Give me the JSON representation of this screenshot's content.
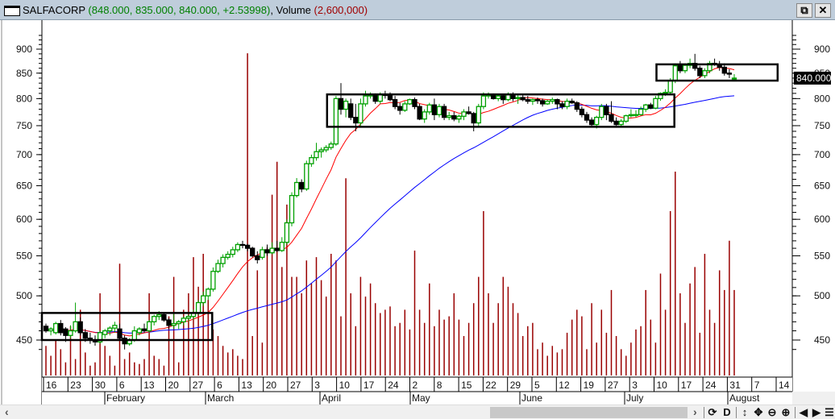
{
  "window": {
    "symbol": "SALFACORP",
    "ohlc_text": "(848.000, 835.000, 840.000, +2.53998)",
    "volume_label": "Volume",
    "volume_text": "(2,600,000)",
    "restore_icon": "restore-icon",
    "close_icon": "close-icon"
  },
  "colors": {
    "up": "#00a000",
    "down": "#000000",
    "ma_fast": "#ff0000",
    "ma_slow": "#0000ff",
    "volume": "#990000",
    "box": "#000000"
  },
  "price_axis": {
    "labels": [
      "900",
      "850",
      "800",
      "750",
      "700",
      "650",
      "600",
      "550",
      "500",
      "450"
    ],
    "current": "840.000"
  },
  "date_axis": {
    "days": [
      "16",
      "23",
      "30",
      "6",
      "13",
      "20",
      "27",
      "6",
      "13",
      "20",
      "27",
      "3",
      "10",
      "17",
      "24",
      "2",
      "8",
      "15",
      "22",
      "29",
      "5",
      "12",
      "19",
      "27",
      "3",
      "10",
      "17",
      "24",
      "31",
      "7",
      "14"
    ],
    "months": [
      "February",
      "March",
      "April",
      "May",
      "June",
      "July",
      "August"
    ]
  },
  "toolbar": {
    "left": "‹",
    "right": "›",
    "refresh": "⟳",
    "d": "D",
    "vzoom": "↕",
    "pan": "✥",
    "zoom_out": "⊖",
    "zoom_in": "⊕",
    "prev": "◀",
    "next": "▶",
    "menu": "☰"
  },
  "chart_data": {
    "type": "candlestick",
    "ylim": [
      420,
      930
    ],
    "scale": "log",
    "ma_periods": [
      10,
      50
    ],
    "candles": [
      [
        465,
        468,
        458,
        460,
        900
      ],
      [
        460,
        464,
        455,
        462,
        600
      ],
      [
        458,
        470,
        456,
        468,
        1100
      ],
      [
        468,
        472,
        455,
        458,
        800
      ],
      [
        462,
        464,
        448,
        455,
        400
      ],
      [
        455,
        466,
        452,
        460,
        1500
      ],
      [
        460,
        492,
        458,
        470,
        500
      ],
      [
        470,
        475,
        455,
        458,
        2000
      ],
      [
        458,
        462,
        448,
        452,
        700
      ],
      [
        452,
        458,
        446,
        450,
        300
      ],
      [
        450,
        455,
        444,
        448,
        400
      ],
      [
        448,
        460,
        446,
        458,
        2500
      ],
      [
        456,
        462,
        452,
        460,
        900
      ],
      [
        460,
        465,
        455,
        463,
        600
      ],
      [
        463,
        470,
        458,
        466,
        300
      ],
      [
        462,
        468,
        450,
        452,
        3400
      ],
      [
        452,
        455,
        440,
        446,
        500
      ],
      [
        446,
        452,
        444,
        450,
        700
      ],
      [
        450,
        465,
        448,
        460,
        400
      ],
      [
        458,
        464,
        455,
        462,
        350
      ],
      [
        462,
        468,
        458,
        460,
        500
      ],
      [
        460,
        472,
        458,
        470,
        2500
      ],
      [
        470,
        478,
        466,
        476,
        600
      ],
      [
        476,
        482,
        472,
        478,
        500
      ],
      [
        478,
        480,
        470,
        472,
        300
      ],
      [
        472,
        474,
        462,
        466,
        1800
      ],
      [
        466,
        480,
        462,
        468,
        3000
      ],
      [
        468,
        472,
        462,
        470,
        400
      ],
      [
        470,
        476,
        466,
        474,
        2000
      ],
      [
        474,
        478,
        470,
        476,
        2500
      ],
      [
        476,
        484,
        472,
        480,
        3600
      ],
      [
        480,
        495,
        478,
        492,
        2700
      ],
      [
        492,
        505,
        488,
        500,
        3700
      ],
      [
        500,
        510,
        495,
        508,
        2300
      ],
      [
        508,
        535,
        505,
        530,
        1400
      ],
      [
        530,
        545,
        528,
        540,
        1200
      ],
      [
        540,
        552,
        535,
        548,
        900
      ],
      [
        548,
        556,
        545,
        552,
        700
      ],
      [
        552,
        562,
        548,
        558,
        800
      ],
      [
        558,
        568,
        555,
        565,
        600
      ],
      [
        565,
        570,
        560,
        564,
        500
      ],
      [
        564,
        566,
        556,
        560,
        9800
      ],
      [
        560,
        562,
        548,
        550,
        1200
      ],
      [
        550,
        556,
        540,
        545,
        3200
      ],
      [
        548,
        562,
        545,
        558,
        1000
      ],
      [
        558,
        565,
        550,
        554,
        3900
      ],
      [
        554,
        568,
        552,
        560,
        5500
      ],
      [
        560,
        570,
        555,
        557,
        6500
      ],
      [
        557,
        575,
        555,
        568,
        3300
      ],
      [
        568,
        600,
        565,
        595,
        5200
      ],
      [
        595,
        640,
        590,
        635,
        3000
      ],
      [
        635,
        662,
        632,
        655,
        3000
      ],
      [
        655,
        660,
        640,
        645,
        2500
      ],
      [
        645,
        690,
        642,
        685,
        3500
      ],
      [
        685,
        700,
        680,
        695,
        2800
      ],
      [
        695,
        720,
        690,
        705,
        3600
      ],
      [
        705,
        712,
        695,
        708,
        2900
      ],
      [
        708,
        716,
        704,
        712,
        2400
      ],
      [
        712,
        722,
        708,
        718,
        3700
      ],
      [
        718,
        805,
        715,
        800,
        3500
      ],
      [
        800,
        830,
        770,
        780,
        1800
      ],
      [
        780,
        800,
        765,
        795,
        6000
      ],
      [
        790,
        800,
        760,
        765,
        2500
      ],
      [
        765,
        790,
        740,
        755,
        1500
      ],
      [
        755,
        800,
        750,
        790,
        3000
      ],
      [
        790,
        815,
        785,
        805,
        2400
      ],
      [
        805,
        812,
        800,
        808,
        2800
      ],
      [
        808,
        810,
        790,
        795,
        2200
      ],
      [
        795,
        812,
        790,
        808,
        1900
      ],
      [
        808,
        815,
        800,
        806,
        2000
      ],
      [
        806,
        812,
        795,
        798,
        2100
      ],
      [
        798,
        805,
        780,
        785,
        1500
      ],
      [
        785,
        792,
        770,
        778,
        1600
      ],
      [
        778,
        795,
        775,
        790,
        2000
      ],
      [
        790,
        800,
        788,
        798,
        1400
      ],
      [
        798,
        802,
        780,
        785,
        3800
      ],
      [
        785,
        790,
        760,
        762,
        2000
      ],
      [
        762,
        780,
        755,
        775,
        1600
      ],
      [
        775,
        792,
        770,
        788,
        2800
      ],
      [
        788,
        800,
        760,
        770,
        1500
      ],
      [
        770,
        790,
        765,
        785,
        2000
      ],
      [
        785,
        790,
        760,
        765,
        1700
      ],
      [
        765,
        775,
        760,
        768,
        1800
      ],
      [
        768,
        775,
        758,
        762,
        2500
      ],
      [
        762,
        770,
        755,
        767,
        1700
      ],
      [
        767,
        780,
        760,
        775,
        1200
      ],
      [
        775,
        785,
        770,
        772,
        1600
      ],
      [
        772,
        775,
        740,
        755,
        2200
      ],
      [
        755,
        790,
        750,
        785,
        3000
      ],
      [
        785,
        812,
        780,
        805,
        5000
      ],
      [
        805,
        812,
        800,
        808,
        2500
      ],
      [
        808,
        810,
        798,
        800,
        1600
      ],
      [
        800,
        808,
        795,
        805,
        2200
      ],
      [
        805,
        808,
        790,
        798,
        3000
      ],
      [
        798,
        812,
        795,
        808,
        2700
      ],
      [
        808,
        812,
        795,
        800,
        2200
      ],
      [
        800,
        806,
        790,
        802,
        1900
      ],
      [
        802,
        808,
        795,
        798,
        1200
      ],
      [
        798,
        805,
        790,
        795,
        1500
      ],
      [
        795,
        800,
        788,
        798,
        1600
      ],
      [
        798,
        802,
        790,
        796,
        800
      ],
      [
        796,
        800,
        785,
        790,
        1000
      ],
      [
        790,
        798,
        788,
        795,
        600
      ],
      [
        795,
        802,
        790,
        798,
        900
      ],
      [
        798,
        800,
        780,
        790,
        700
      ],
      [
        790,
        795,
        780,
        785,
        800
      ],
      [
        785,
        800,
        780,
        795,
        1300
      ],
      [
        795,
        800,
        790,
        792,
        1700
      ],
      [
        792,
        795,
        775,
        780,
        2000
      ],
      [
        780,
        785,
        765,
        770,
        1800
      ],
      [
        770,
        775,
        755,
        760,
        800
      ],
      [
        760,
        765,
        748,
        752,
        2200
      ],
      [
        752,
        768,
        745,
        765,
        1000
      ],
      [
        765,
        790,
        760,
        785,
        2000
      ],
      [
        785,
        790,
        760,
        770,
        1300
      ],
      [
        770,
        795,
        755,
        758,
        2600
      ],
      [
        758,
        765,
        750,
        752,
        1200
      ],
      [
        752,
        762,
        748,
        758,
        800
      ],
      [
        758,
        770,
        755,
        768,
        600
      ],
      [
        768,
        780,
        765,
        770,
        1000
      ],
      [
        770,
        778,
        765,
        770,
        1400
      ],
      [
        770,
        785,
        768,
        780,
        1500
      ],
      [
        780,
        790,
        775,
        788,
        2600
      ],
      [
        788,
        792,
        780,
        782,
        1700
      ],
      [
        782,
        805,
        780,
        800,
        1000
      ],
      [
        800,
        812,
        796,
        810,
        3100
      ],
      [
        810,
        818,
        805,
        812,
        2000
      ],
      [
        812,
        840,
        808,
        835,
        5000
      ],
      [
        835,
        870,
        830,
        865,
        6200
      ],
      [
        865,
        875,
        850,
        855,
        2500
      ],
      [
        855,
        870,
        850,
        866,
        1600
      ],
      [
        866,
        880,
        860,
        870,
        2800
      ],
      [
        870,
        890,
        855,
        860,
        3300
      ],
      [
        860,
        865,
        840,
        845,
        1300
      ],
      [
        845,
        860,
        840,
        855,
        3700
      ],
      [
        855,
        875,
        850,
        870,
        2000
      ],
      [
        870,
        880,
        865,
        868,
        1600
      ],
      [
        868,
        875,
        855,
        862,
        3200
      ],
      [
        862,
        870,
        845,
        850,
        2600
      ],
      [
        850,
        858,
        840,
        848,
        4100
      ],
      [
        838,
        848,
        835,
        840,
        2600
      ]
    ],
    "boxes": [
      {
        "from": 0,
        "to": 33,
        "low": 450,
        "high": 480
      },
      {
        "from": 58,
        "to": 127,
        "low": 748,
        "high": 808
      },
      {
        "from": 125,
        "to": 148,
        "low": 835,
        "high": 868
      }
    ]
  }
}
